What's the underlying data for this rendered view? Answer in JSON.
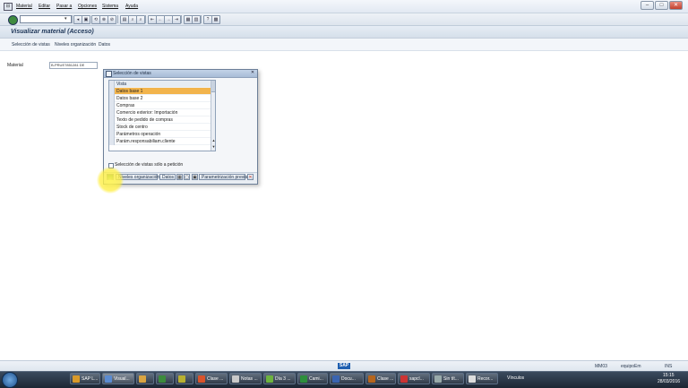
{
  "menubar": {
    "items": [
      "Material",
      "Editar",
      "Pasar a",
      "Opciones",
      "Sistema",
      "Ayuda"
    ]
  },
  "toolbar": {
    "command_value": ""
  },
  "page": {
    "title": "Visualizar material (Acceso)"
  },
  "app_toolbar": {
    "buttons": [
      "Selección de vistas",
      "Niveles organización",
      "Datos"
    ]
  },
  "material": {
    "label": "Material",
    "value": "B-PRUE7851281 DE"
  },
  "dialog": {
    "title": "Selección de vistas",
    "column_header": "Vista",
    "views": [
      "Datos base 1",
      "Datos base 2",
      "Compras",
      "Comercio exterior: Importación",
      "Texto de pedido de compras",
      "Stock de centro",
      "Parámetros operación",
      "Parám.responsabiliam.cliente"
    ],
    "selected_index": 0,
    "checkbox_label": "Selección de vistas sólo a petición",
    "buttons": {
      "org_levels": "Niveles organización",
      "data": "Datos",
      "default_params": "Parametrización previa"
    }
  },
  "statusbar": {
    "logo": "SAP",
    "system": "MM03",
    "host": "equipoEm",
    "mode": "INS"
  },
  "taskbar": {
    "items": [
      {
        "label": "SAP L...",
        "color": "#d99a2b"
      },
      {
        "label": "Visual...",
        "color": "#5b8bd0"
      },
      {
        "label": "",
        "color": "#d9a441"
      },
      {
        "label": "",
        "color": "#3c8b3c"
      },
      {
        "label": "",
        "color": "#b8b030"
      },
      {
        "label": "Clase ...",
        "color": "#d9532b"
      },
      {
        "label": "Notas ...",
        "color": "#c9c9c9"
      },
      {
        "label": "Día 3 ...",
        "color": "#6db33f"
      },
      {
        "label": "Cami...",
        "color": "#2d8f3c"
      },
      {
        "label": "Docu...",
        "color": "#3a64b0"
      },
      {
        "label": "Clase ...",
        "color": "#b5651d"
      },
      {
        "label": "sapcl...",
        "color": "#c33"
      },
      {
        "label": "Sin tít...",
        "color": "#9aa"
      },
      {
        "label": "Recor...",
        "color": "#ddd"
      }
    ],
    "tray": {
      "links": "Vínculos",
      "time": "15:15",
      "date": "28/03/2016"
    }
  }
}
